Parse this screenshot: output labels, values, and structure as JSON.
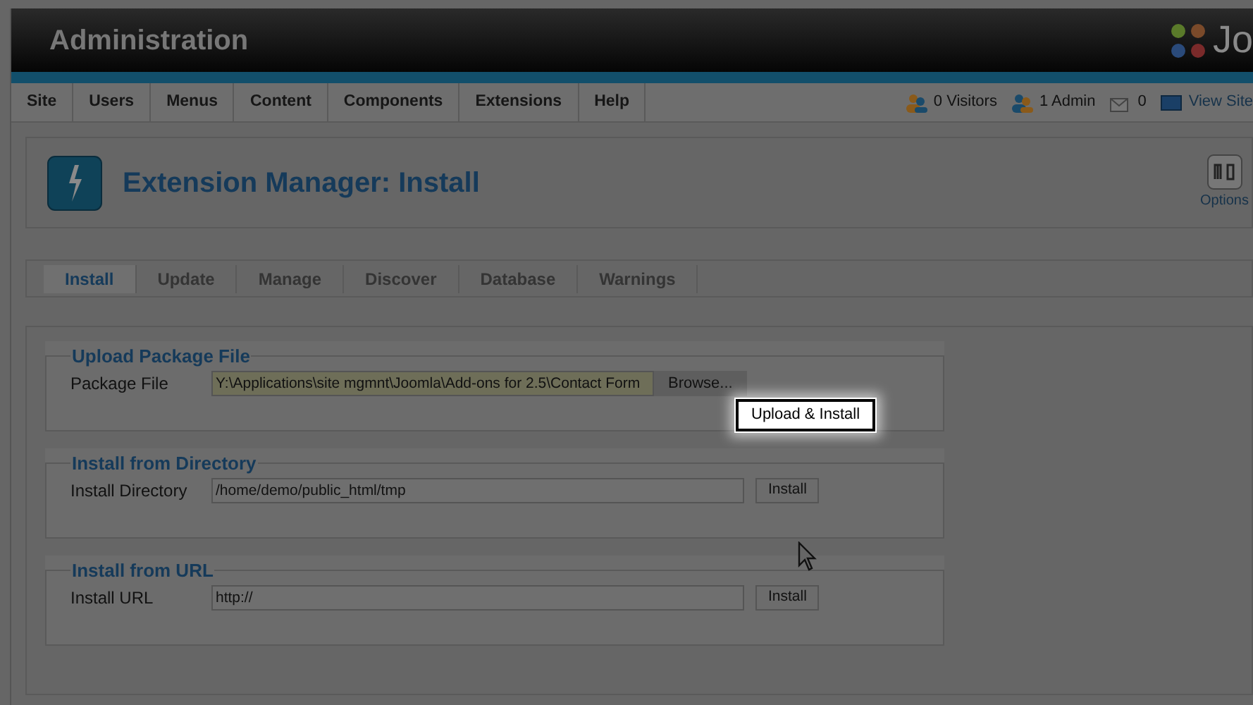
{
  "header": {
    "title": "Administration",
    "logo_text": "Jo"
  },
  "menu": {
    "items": [
      "Site",
      "Users",
      "Menus",
      "Content",
      "Components",
      "Extensions",
      "Help"
    ]
  },
  "status": [
    {
      "kind": "users",
      "text": "0 Visitors"
    },
    {
      "kind": "admin",
      "text": "1 Admin"
    },
    {
      "kind": "mail",
      "text": "0"
    },
    {
      "kind": "site",
      "text": "View Site"
    }
  ],
  "toolbar": {
    "title": "Extension Manager: Install",
    "options_label": "Options"
  },
  "subnav": [
    {
      "label": "Install",
      "selected": true
    },
    {
      "label": "Update",
      "selected": false
    },
    {
      "label": "Manage",
      "selected": false
    },
    {
      "label": "Discover",
      "selected": false
    },
    {
      "label": "Database",
      "selected": false
    },
    {
      "label": "Warnings",
      "selected": false
    }
  ],
  "sections": [
    {
      "kind": "file",
      "legend": "Upload Package File",
      "label": "Package File",
      "value": "Y:\\Applications\\site mgmnt\\Joomla\\Add-ons for 2.5\\Contact Form",
      "browse": "Browse...",
      "button": "Upload & Install"
    },
    {
      "kind": "text",
      "legend": "Install from Directory",
      "label": "Install Directory",
      "value": "/home/demo/public_html/tmp",
      "button": "Install"
    },
    {
      "kind": "text",
      "legend": "Install from URL",
      "label": "Install URL",
      "value": "http://",
      "button": "Install"
    }
  ]
}
